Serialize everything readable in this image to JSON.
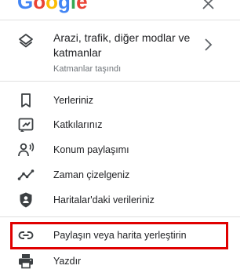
{
  "header": {
    "logo_letters": [
      "G",
      "o",
      "o",
      "g",
      "l",
      "e"
    ],
    "logo_colors": [
      "#4285F4",
      "#EA4335",
      "#FBBC05",
      "#4285F4",
      "#34A853",
      "#EA4335"
    ],
    "close_glyph": "×"
  },
  "layers": {
    "title": "Arazi, trafik, diğer modlar ve katmanlar",
    "subtitle": "Katmanlar taşındı",
    "icon": "layers-icon",
    "chevron": "chevron-right-icon"
  },
  "menu": [
    {
      "label": "Yerleriniz",
      "icon": "bookmark-icon"
    },
    {
      "label": "Katkılarınız",
      "icon": "contributions-icon"
    },
    {
      "label": "Konum paylaşımı",
      "icon": "location-sharing-icon"
    },
    {
      "label": "Zaman çizelgeniz",
      "icon": "timeline-icon"
    },
    {
      "label": "Haritalar'daki verileriniz",
      "icon": "shield-person-icon"
    },
    {
      "label": "Paylaşın veya harita yerleştirin",
      "icon": "link-icon"
    },
    {
      "label": "Yazdır",
      "icon": "print-icon"
    }
  ],
  "colors": {
    "icon": "#3c4043",
    "divider": "#e0e0e0",
    "highlight_border": "#e00000",
    "subtitle": "#70757a"
  }
}
